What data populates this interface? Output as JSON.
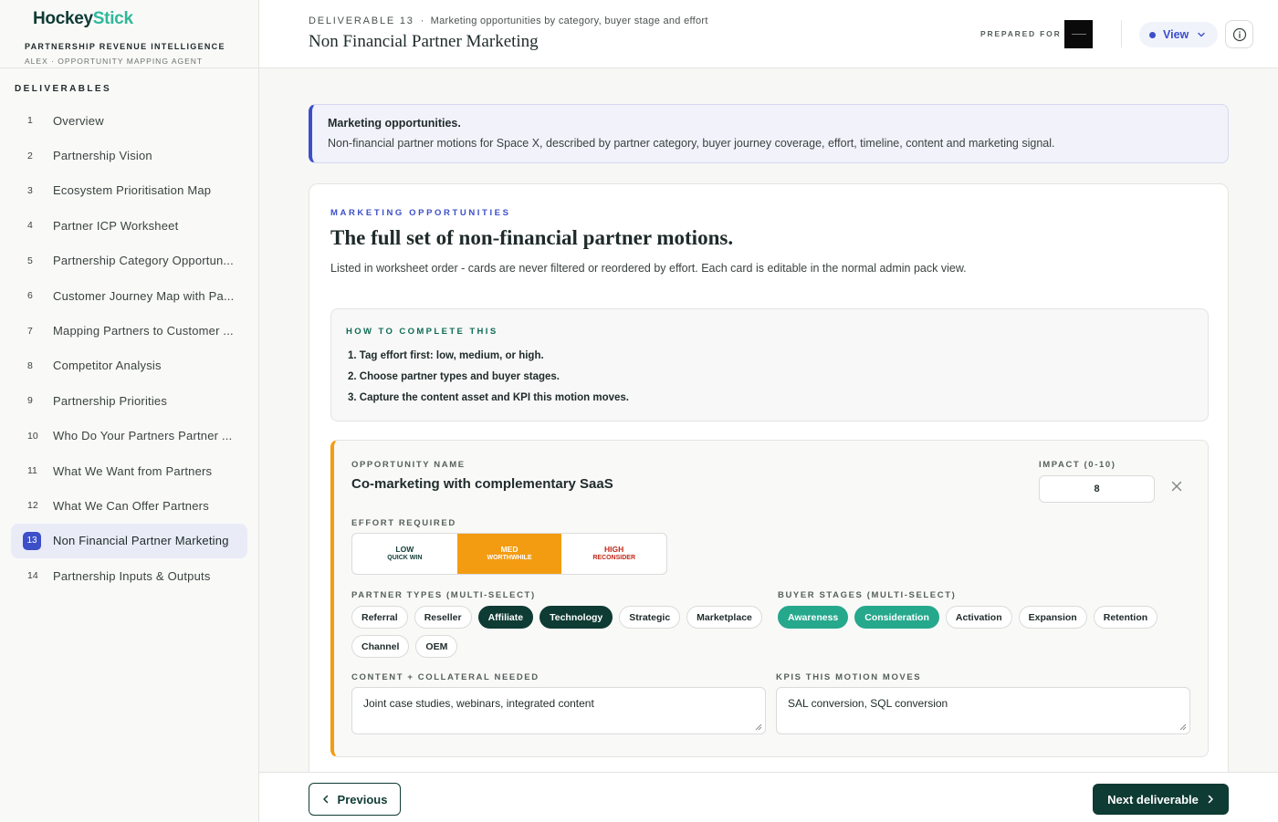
{
  "brand": {
    "logo_part1": "Hockey",
    "logo_part2": "Stick",
    "subtitle": "PARTNERSHIP REVENUE INTELLIGENCE",
    "agent": "ALEX · OPPORTUNITY MAPPING AGENT"
  },
  "sidebar": {
    "heading": "DELIVERABLES",
    "items": [
      {
        "num": "1",
        "label": "Overview"
      },
      {
        "num": "2",
        "label": "Partnership Vision"
      },
      {
        "num": "3",
        "label": "Ecosystem Prioritisation Map"
      },
      {
        "num": "4",
        "label": "Partner ICP Worksheet"
      },
      {
        "num": "5",
        "label": "Partnership Category Opportun..."
      },
      {
        "num": "6",
        "label": "Customer Journey Map with Pa..."
      },
      {
        "num": "7",
        "label": "Mapping Partners to Customer ..."
      },
      {
        "num": "8",
        "label": "Competitor Analysis"
      },
      {
        "num": "9",
        "label": "Partnership Priorities"
      },
      {
        "num": "10",
        "label": "Who Do Your Partners Partner ..."
      },
      {
        "num": "11",
        "label": "What We Want from Partners"
      },
      {
        "num": "12",
        "label": "What We Can Offer Partners"
      },
      {
        "num": "13",
        "label": "Non Financial Partner Marketing"
      },
      {
        "num": "14",
        "label": "Partnership Inputs & Outputs"
      }
    ],
    "active_index": 12
  },
  "header": {
    "deliverable": "DELIVERABLE 13",
    "separator": "·",
    "crumb_desc": "Marketing opportunities by category, buyer stage and effort",
    "title": "Non Financial Partner Marketing",
    "prepared_for": "PREPARED FOR",
    "view_label": "View"
  },
  "notice": {
    "title": "Marketing opportunities.",
    "body": "Non-financial partner motions for Space X, described by partner category, buyer journey coverage, effort, timeline, content and marketing signal."
  },
  "section": {
    "eyebrow": "MARKETING OPPORTUNITIES",
    "title": "The full set of non-financial partner motions.",
    "description": "Listed in worksheet order - cards are never filtered or reordered by effort. Each card is editable in the normal admin pack view."
  },
  "howto": {
    "heading": "HOW TO COMPLETE THIS",
    "steps": [
      "1. Tag effort first: low, medium, or high.",
      "2. Choose partner types and buyer stages.",
      "3. Capture the content asset and KPI this motion moves."
    ]
  },
  "opportunity": {
    "name_label": "OPPORTUNITY NAME",
    "name": "Co-marketing with complementary SaaS",
    "impact_label": "IMPACT (0-10)",
    "impact": "8",
    "effort_label": "EFFORT REQUIRED",
    "effort": [
      {
        "a": "LOW",
        "b": "QUICK WIN"
      },
      {
        "a": "MED",
        "b": "WORTHWHILE"
      },
      {
        "a": "HIGH",
        "b": "RECONSIDER"
      }
    ],
    "effort_selected": "MED",
    "partner_types_label": "PARTNER TYPES (MULTI-SELECT)",
    "partner_types": [
      "Referral",
      "Reseller",
      "Affiliate",
      "Technology",
      "Strategic",
      "Marketplace",
      "Channel",
      "OEM"
    ],
    "partner_types_selected": [
      "Affiliate",
      "Technology"
    ],
    "buyer_stages_label": "BUYER STAGES (MULTI-SELECT)",
    "buyer_stages": [
      "Awareness",
      "Consideration",
      "Activation",
      "Expansion",
      "Retention"
    ],
    "buyer_stages_selected": [
      "Awareness",
      "Consideration"
    ],
    "content_label": "CONTENT + COLLATERAL NEEDED",
    "content": "Joint case studies, webinars, integrated content",
    "kpis_label": "KPIS THIS MOTION MOVES",
    "kpis": "SAL conversion, SQL conversion"
  },
  "footer": {
    "previous": "Previous",
    "next": "Next deliverable"
  },
  "colors": {
    "brand_dark": "#0e3b33",
    "brand_teal": "#2fb89a",
    "accent_blue": "#3c4fc9",
    "effort_med": "#f39c12",
    "effort_high": "#c0281b"
  }
}
